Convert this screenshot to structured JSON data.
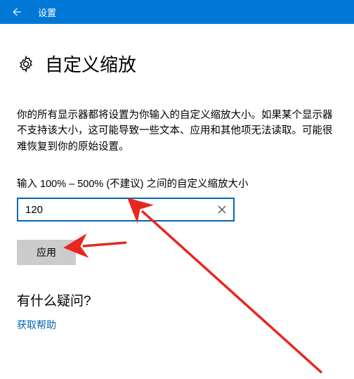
{
  "header": {
    "title": "设置"
  },
  "page": {
    "title": "自定义缩放",
    "description": "你的所有显示器都将设置为你输入的自定义缩放大小。如果某个显示器不支持该大小，这可能导致一些文本、应用和其他项无法读取。可能很难恢复到你的原始设置。",
    "field_label": "输入 100% – 500% (不建议) 之间的自定义缩放大小",
    "input_value": "120",
    "apply_label": "应用"
  },
  "help": {
    "heading": "有什么疑问?",
    "link": "获取帮助"
  }
}
